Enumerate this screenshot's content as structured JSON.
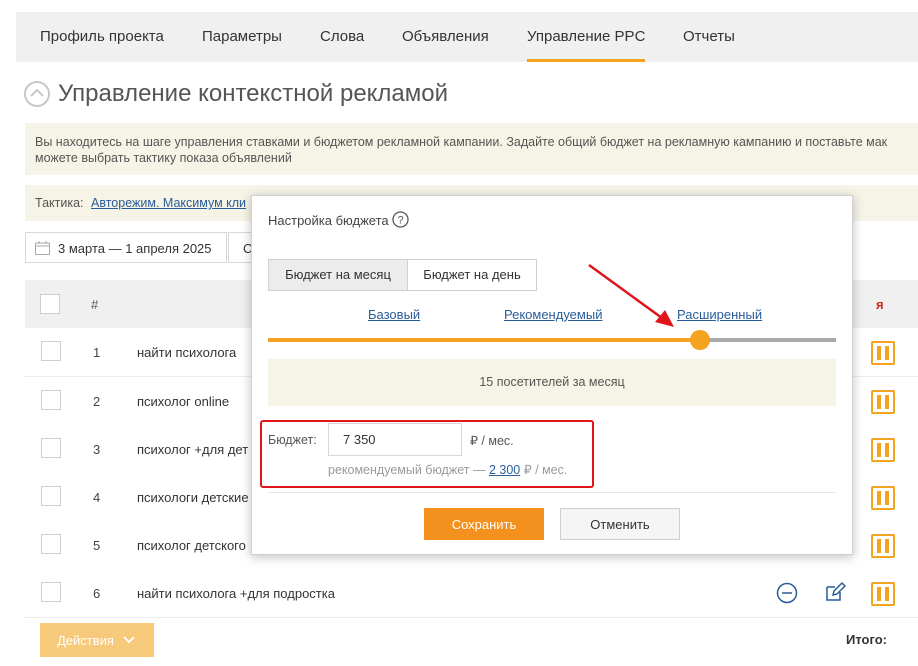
{
  "nav": {
    "tabs": [
      {
        "label": "Профиль проекта"
      },
      {
        "label": "Параметры"
      },
      {
        "label": "Слова"
      },
      {
        "label": "Объявления"
      },
      {
        "label": "Управление PPC"
      },
      {
        "label": "Отчеты"
      }
    ],
    "active": "Управление PPC"
  },
  "page": {
    "title": "Управление контекстной рекламой",
    "info_line1": "Вы находитесь на шаге управления ставками и бюджетом рекламной кампании. Задайте общий бюджет на рекламную кампанию и поставьте мак",
    "info_line2": "можете выбрать тактику показа объявлений",
    "tactic_label": "Тактика:",
    "tactic_value": "Авторежим. Максимум кли"
  },
  "date_range": "3 марта — 1 апреля 2025",
  "date_btn2": "С",
  "table": {
    "header_num": "#",
    "header_partial": "я",
    "rows": [
      {
        "num": "1",
        "keyword": "найти психолога"
      },
      {
        "num": "2",
        "keyword": "психолог online"
      },
      {
        "num": "3",
        "keyword": "психолог +для дет"
      },
      {
        "num": "4",
        "keyword": "психологи детские"
      },
      {
        "num": "5",
        "keyword": "психолог детского"
      },
      {
        "num": "6",
        "keyword": "найти психолога +для подростка"
      }
    ]
  },
  "footer": {
    "actions_label": "Действия",
    "total_label": "Итого:"
  },
  "modal": {
    "title": "Настройка бюджета",
    "tabs": [
      "Бюджет на месяц",
      "Бюджет на день"
    ],
    "active_tab": "Бюджет на месяц",
    "levels": [
      "Базовый",
      "Рекомендуемый",
      "Расширенный"
    ],
    "slider_fraction": 0.76,
    "visitors_text": "15 посетителей за месяц",
    "budget_label": "Бюджет:",
    "budget_value": "7 350",
    "budget_unit": "₽ / мес.",
    "rec_prefix": "рекомендуемый бюджет —",
    "rec_value": "2 300",
    "rec_suffix": "₽ / мес.",
    "save_label": "Сохранить",
    "cancel_label": "Отменить"
  },
  "colors": {
    "accent": "#f4a321",
    "save": "#f4901d",
    "link": "#2a5c9a",
    "highlight": "#e0141b"
  }
}
